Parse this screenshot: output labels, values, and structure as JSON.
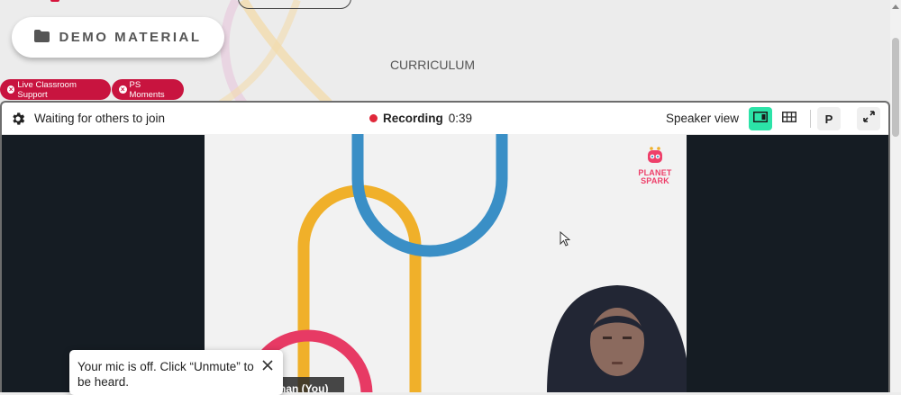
{
  "header": {
    "demo_material_label": "DEMO MATERIAL",
    "curriculum_label": "CURRICULUM"
  },
  "tags": [
    {
      "label": "Live Classroom Support"
    },
    {
      "label": "PS Moments"
    }
  ],
  "meeting": {
    "status_text": "Waiting for others to join",
    "recording_label": "Recording",
    "recording_time": "0:39",
    "view_label": "Speaker view",
    "participant_initial": "P",
    "self_name_tag": "han (You)"
  },
  "slide": {
    "logo_line1": "PLANET",
    "logo_line2": "SPARK"
  },
  "toast": {
    "message": "Your mic is off. Click “Unmute” to be heard."
  },
  "colors": {
    "accent_view": "#2ce3a8",
    "tag_bg": "#c8143f",
    "recording_dot": "#e0283a",
    "arch_blue": "#3a8fc6",
    "arch_yellow": "#f0b02a",
    "arch_pink": "#e73a64"
  },
  "icons": {
    "folder": "folder-icon",
    "gear": "gear-icon",
    "speaker_view": "speaker-view-icon",
    "gallery_view": "gallery-view-icon",
    "fullscreen": "fullscreen-icon",
    "close": "close-icon"
  }
}
